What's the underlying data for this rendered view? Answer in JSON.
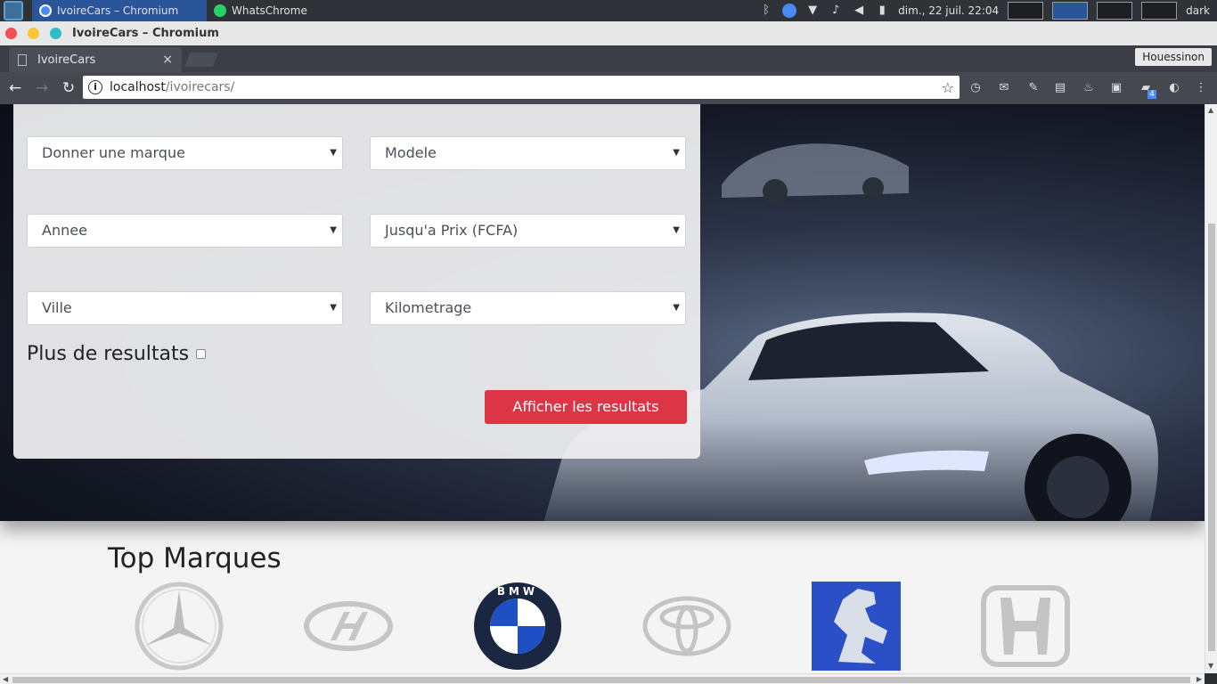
{
  "taskbar": {
    "tabs": [
      {
        "label": "IvoireCars – Chromium",
        "active": true
      },
      {
        "label": "WhatsChrome",
        "active": false
      }
    ],
    "datetime": "dim., 22 juil. 22:04",
    "theme_label": "dark"
  },
  "window": {
    "title": "IvoireCars – Chromium"
  },
  "browser": {
    "tab_title": "IvoireCars",
    "tab_close": "×",
    "profile_name": "Houessinon",
    "url_host": "localhost",
    "url_path": "/ivoirecars/",
    "ext_badge_downloads": "4"
  },
  "search_form": {
    "selects": [
      {
        "label": "Donner une marque"
      },
      {
        "label": "Modele"
      },
      {
        "label": "Annee"
      },
      {
        "label": "Jusqu'a Prix (FCFA)"
      },
      {
        "label": "Ville"
      },
      {
        "label": "Kilometrage"
      }
    ],
    "more_results_label": "Plus de resultats",
    "submit_label": "Afficher les resultats"
  },
  "top_brands": {
    "title": "Top Marques",
    "brands": [
      "mercedes-logo",
      "hyundai-logo",
      "bmw-logo",
      "toyota-logo",
      "peugeot-logo",
      "honda-logo"
    ],
    "bmw_lettering": "BMW"
  },
  "colors": {
    "button_red": "#dc3545",
    "taskbar_active": "#2a5599",
    "peugeot_blue": "#2b4fc7",
    "bmw_blue": "#1f4fc4"
  }
}
